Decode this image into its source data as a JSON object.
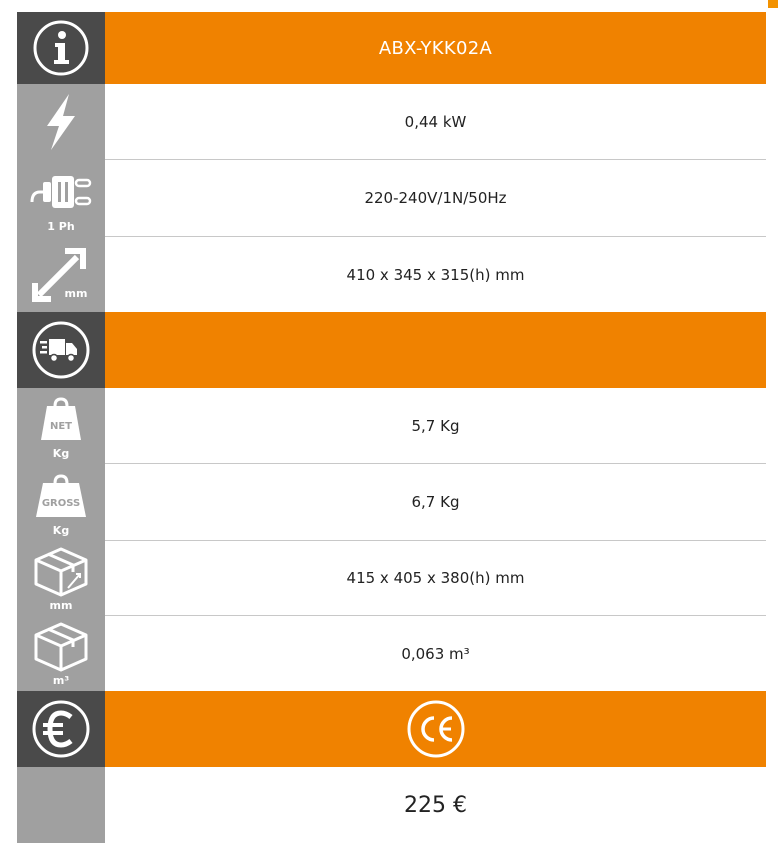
{
  "model": "ABX-YKK02A",
  "specs": {
    "power": "0,44 kW",
    "electrical": "220-240V/1N/50Hz",
    "dimensions": "410 x 345 x 315(h) mm",
    "net_weight": "5,7 Kg",
    "gross_weight": "6,7 Kg",
    "package_dimensions": "415 x 405 x 380(h) mm",
    "volume": "0,063 m³"
  },
  "price": "225 €",
  "icons": {
    "info": "info-icon",
    "power": "lightning-icon",
    "plug": "plug-icon",
    "dimensions": "dimensions-arrow-icon",
    "delivery": "delivery-truck-icon",
    "net_weight": "net-weight-icon",
    "gross_weight": "gross-weight-icon",
    "package": "box-dimensions-icon",
    "volume": "box-volume-icon",
    "euro": "euro-icon",
    "ce": "ce-mark-icon"
  },
  "icon_labels": {
    "plug": "1 Ph",
    "dimensions_unit": "mm",
    "net_tag": "NET",
    "net_unit": "Kg",
    "gross_tag": "GROSS",
    "gross_unit": "Kg",
    "package_unit": "mm",
    "volume_unit": "m³"
  },
  "colors": {
    "accent": "#f08200",
    "dark": "#4a4a4a",
    "grey": "#a0a0a0"
  }
}
